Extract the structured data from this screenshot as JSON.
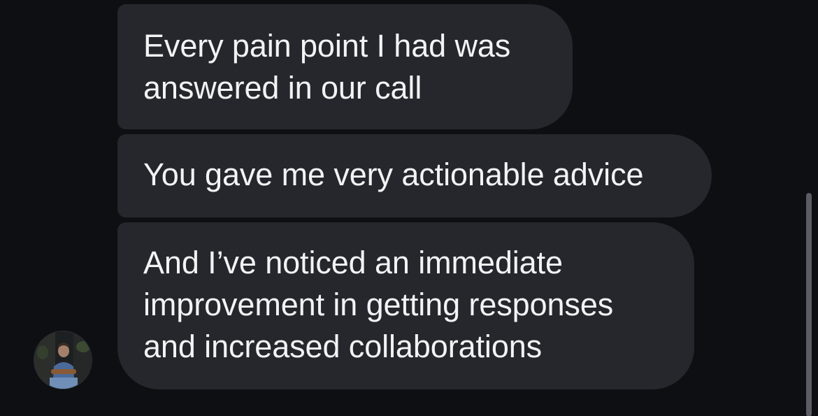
{
  "conversation": {
    "messages": [
      {
        "text": "Every pain point I had was\nanswered in our call"
      },
      {
        "text": "You gave me very actionable advice"
      },
      {
        "text": "And I’ve noticed an immediate\nimprovement in getting responses\nand increased collaborations"
      }
    ]
  },
  "colors": {
    "background": "#0d0f13",
    "bubble": "#25272c",
    "text": "#f2f3f5",
    "scrollbar": "#5a5d63"
  }
}
